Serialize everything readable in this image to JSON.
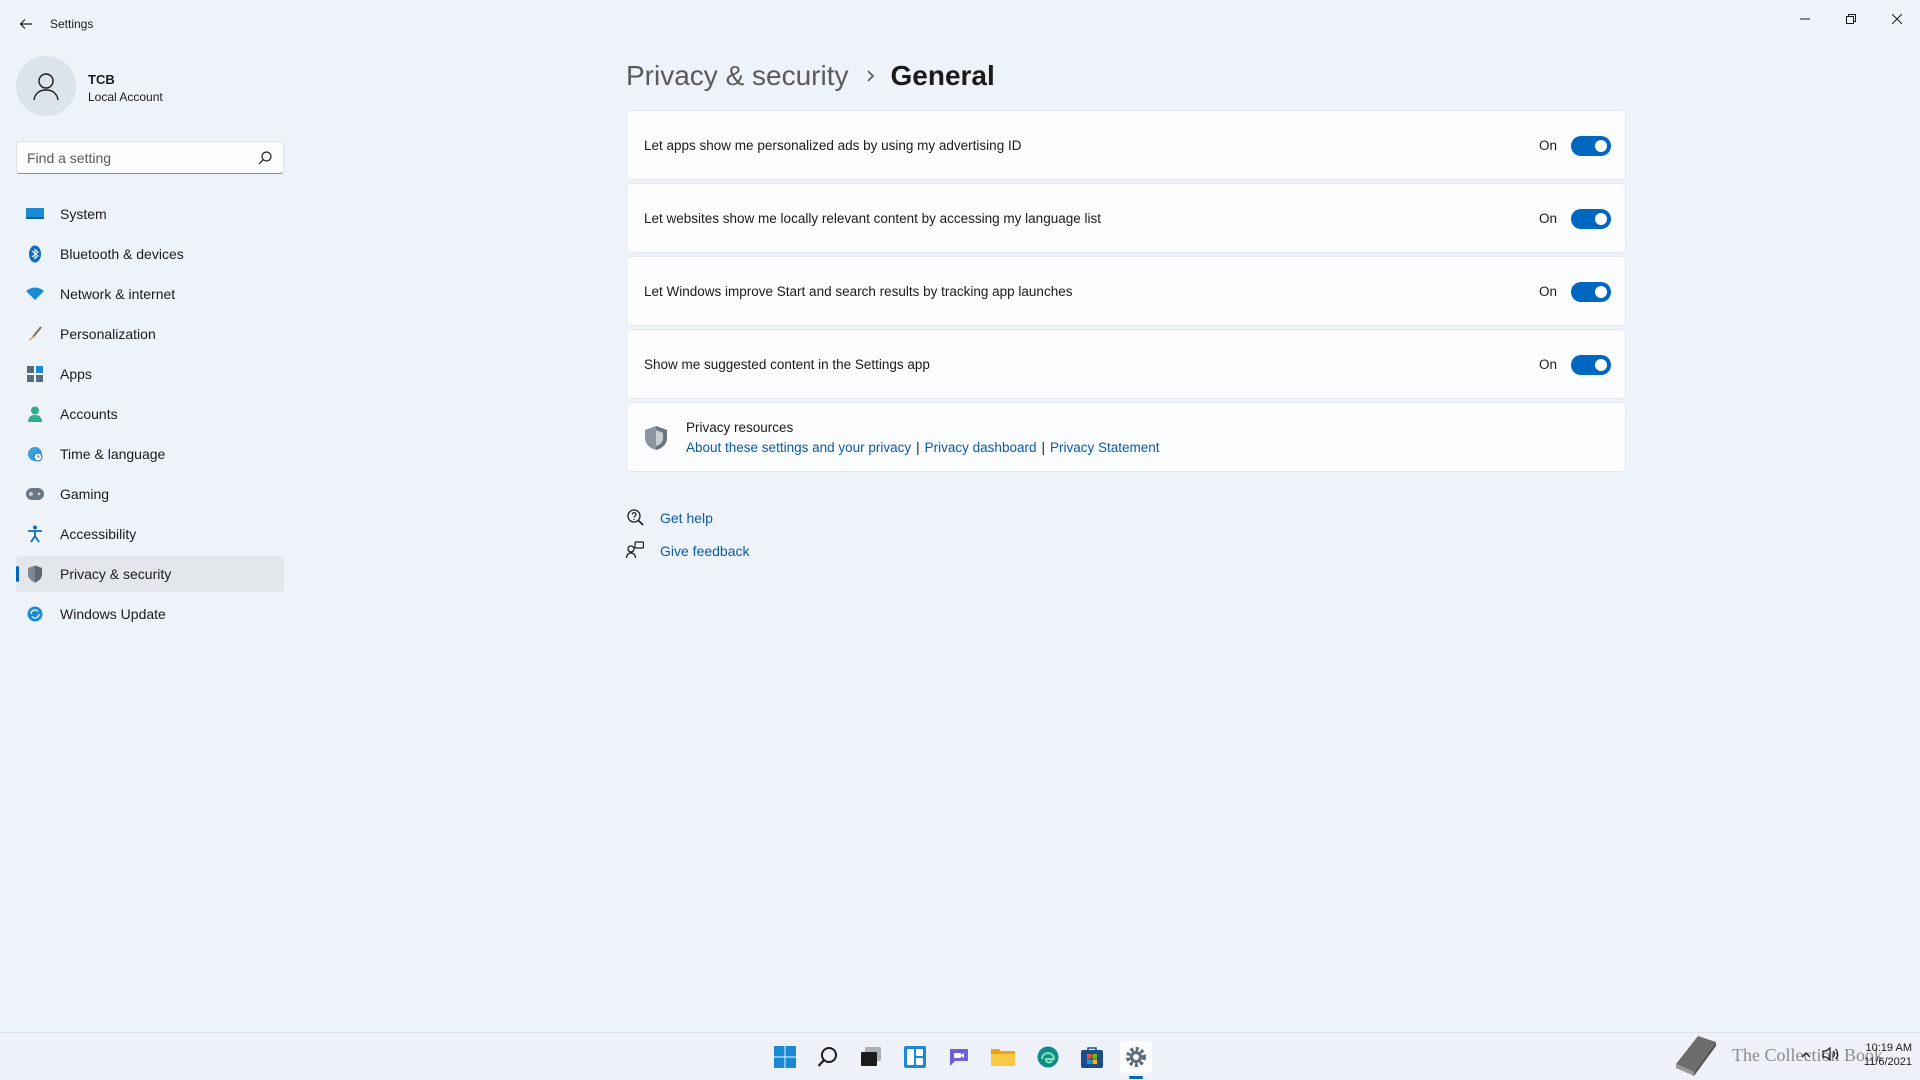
{
  "window": {
    "title": "Settings"
  },
  "profile": {
    "name": "TCB",
    "account_type": "Local Account"
  },
  "search": {
    "placeholder": "Find a setting",
    "value": ""
  },
  "sidebar": {
    "items": [
      {
        "label": "System",
        "icon": "system-icon"
      },
      {
        "label": "Bluetooth & devices",
        "icon": "bluetooth-icon"
      },
      {
        "label": "Network & internet",
        "icon": "wifi-icon"
      },
      {
        "label": "Personalization",
        "icon": "brush-icon"
      },
      {
        "label": "Apps",
        "icon": "apps-icon"
      },
      {
        "label": "Accounts",
        "icon": "account-icon"
      },
      {
        "label": "Time & language",
        "icon": "globe-clock-icon"
      },
      {
        "label": "Gaming",
        "icon": "gamepad-icon"
      },
      {
        "label": "Accessibility",
        "icon": "accessibility-icon"
      },
      {
        "label": "Privacy & security",
        "icon": "shield-icon",
        "active": true
      },
      {
        "label": "Windows Update",
        "icon": "update-icon"
      }
    ]
  },
  "breadcrumb": {
    "parent": "Privacy & security",
    "current": "General"
  },
  "settings": [
    {
      "label": "Let apps show me personalized ads by using my advertising ID",
      "state": "On",
      "enabled": true
    },
    {
      "label": "Let websites show me locally relevant content by accessing my language list",
      "state": "On",
      "enabled": true
    },
    {
      "label": "Let Windows improve Start and search results by tracking app launches",
      "state": "On",
      "enabled": true
    },
    {
      "label": "Show me suggested content in the Settings app",
      "state": "On",
      "enabled": true
    }
  ],
  "privacy_resources": {
    "title": "Privacy resources",
    "links": [
      "About these settings and your privacy",
      "Privacy dashboard",
      "Privacy Statement"
    ],
    "separator": "|"
  },
  "help": {
    "get_help": "Get help",
    "give_feedback": "Give feedback"
  },
  "taskbar": {
    "icons": [
      "start-icon",
      "search-icon",
      "task-view-icon",
      "widgets-icon",
      "chat-icon",
      "file-explorer-icon",
      "edge-icon",
      "store-icon",
      "settings-icon"
    ],
    "active": "settings-icon"
  },
  "watermark": {
    "text": "The Collection Book"
  },
  "tray": {
    "time": "10:19 AM",
    "date": "11/6/2021"
  },
  "colors": {
    "accent": "#0067c0",
    "link": "#0c5aa6",
    "background": "#eef3f9",
    "card": "#fbfcfd"
  }
}
